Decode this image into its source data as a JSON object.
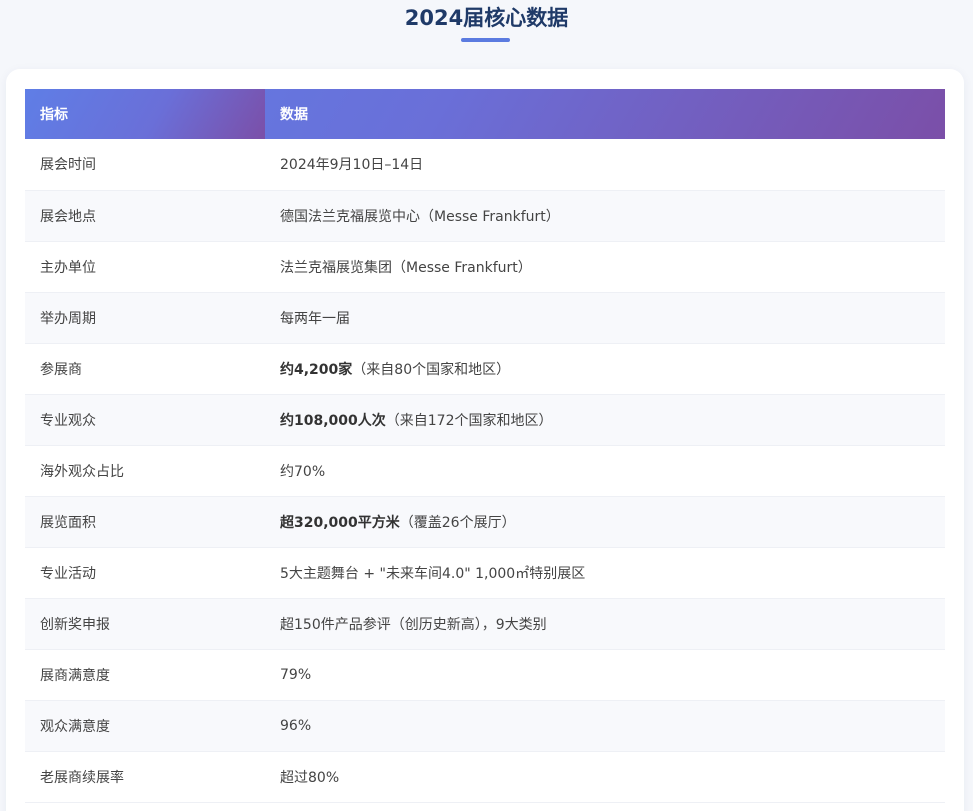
{
  "page": {
    "title": "2024届核心数据"
  },
  "table": {
    "headers": {
      "metric": "指标",
      "value": "数据"
    },
    "rows": [
      {
        "metric": "展会时间",
        "bold": "",
        "value": "2024年9月10日–14日"
      },
      {
        "metric": "展会地点",
        "bold": "",
        "value": "德国法兰克福展览中心（Messe Frankfurt）"
      },
      {
        "metric": "主办单位",
        "bold": "",
        "value": "法兰克福展览集团（Messe Frankfurt）"
      },
      {
        "metric": "举办周期",
        "bold": "",
        "value": "每两年一届"
      },
      {
        "metric": "参展商",
        "bold": "约4,200家",
        "value": "（来自80个国家和地区）"
      },
      {
        "metric": "专业观众",
        "bold": "约108,000人次",
        "value": "（来自172个国家和地区）"
      },
      {
        "metric": "海外观众占比",
        "bold": "",
        "value": "约70%"
      },
      {
        "metric": "展览面积",
        "bold": "超320,000平方米",
        "value": "（覆盖26个展厅）"
      },
      {
        "metric": "专业活动",
        "bold": "",
        "value": "5大主题舞台 + \"未来车间4.0\" 1,000㎡特别展区"
      },
      {
        "metric": "创新奖申报",
        "bold": "",
        "value": "超150件产品参评（创历史新高），9大类别"
      },
      {
        "metric": "展商满意度",
        "bold": "",
        "value": "79%"
      },
      {
        "metric": "观众满意度",
        "bold": "",
        "value": "96%"
      },
      {
        "metric": "老展商续展率",
        "bold": "",
        "value": "超过80%"
      }
    ]
  },
  "colors": {
    "title": "#1f3a68",
    "accent": "#5b7be0",
    "header_gradient_start": "#5f7ee6",
    "header_gradient_end": "#7b4fa8"
  }
}
